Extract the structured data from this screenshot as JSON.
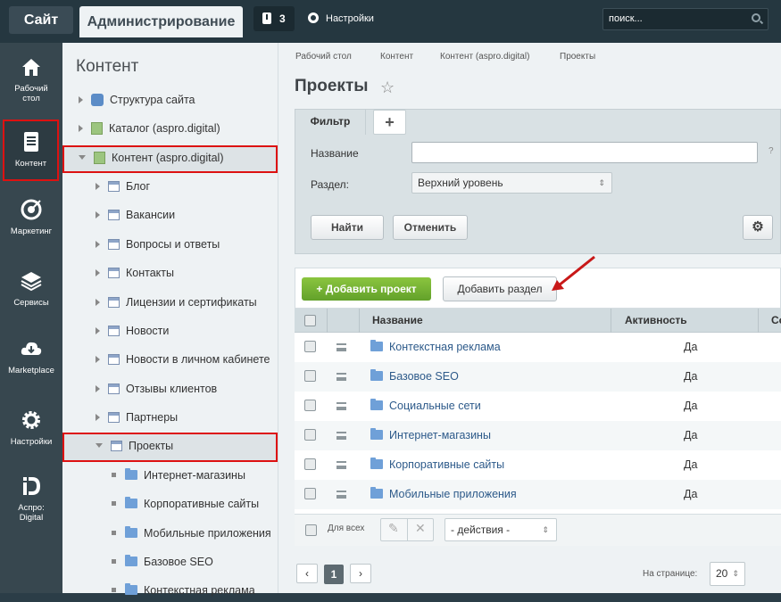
{
  "topbar": {
    "site_tab": "Сайт",
    "admin_tab": "Администрирование",
    "notifications_count": "3",
    "settings_label": "Настройки",
    "search_placeholder": "поиск..."
  },
  "leftnav": [
    {
      "label1": "Рабочий",
      "label2": "стол",
      "icon": "home-icon"
    },
    {
      "label1": "Контент",
      "label2": "",
      "icon": "document-icon"
    },
    {
      "label1": "Маркетинг",
      "label2": "",
      "icon": "target-icon"
    },
    {
      "label1": "Сервисы",
      "label2": "",
      "icon": "layers-icon"
    },
    {
      "label1": "Marketplace",
      "label2": "",
      "icon": "cloud-download-icon"
    },
    {
      "label1": "Настройки",
      "label2": "",
      "icon": "gear-icon"
    },
    {
      "label1": "Аспро:",
      "label2": "Digital",
      "icon": "aspro-logo-icon"
    }
  ],
  "tree": {
    "title": "Контент",
    "items": [
      "Структура сайта",
      "Каталог (aspro.digital)",
      "Контент (aspro.digital)",
      "Блог",
      "Вакансии",
      "Вопросы и ответы",
      "Контакты",
      "Лицензии и сертификаты",
      "Новости",
      "Новости в личном кабинете",
      "Отзывы клиентов",
      "Партнеры",
      "Проекты",
      "Интернет-магазины",
      "Корпоративные сайты",
      "Мобильные приложения",
      "Базовое SEO",
      "Контекстная реклама"
    ]
  },
  "breadcrumb": [
    "Рабочий стол",
    "Контент",
    "Контент (aspro.digital)",
    "Проекты"
  ],
  "page_title": "Проекты",
  "filter": {
    "tab": "Фильтр",
    "add_tab": "+",
    "name_label": "Название",
    "help": "?",
    "section_label": "Раздел:",
    "section_value": "Верхний уровень",
    "find": "Найти",
    "cancel": "Отменить"
  },
  "toolbar": {
    "add_project": "Добавить проект",
    "add_section": "Добавить раздел"
  },
  "grid": {
    "columns": [
      "Название",
      "Активность",
      "Со"
    ],
    "rows": [
      {
        "name": "Контекстная реклама",
        "active": "Да"
      },
      {
        "name": "Базовое SEO",
        "active": "Да"
      },
      {
        "name": "Социальные сети",
        "active": "Да"
      },
      {
        "name": "Интернет-магазины",
        "active": "Да"
      },
      {
        "name": "Корпоративные сайты",
        "active": "Да"
      },
      {
        "name": "Мобильные приложения",
        "active": "Да"
      }
    ],
    "for_all": "Для всех",
    "actions": "- действия -"
  },
  "pager": {
    "prev": "‹",
    "current": "1",
    "next": "›",
    "per_page_label": "На странице:",
    "per_page": "20"
  },
  "colors": {
    "highlight": "#dd1111",
    "green": "#6aa92f",
    "accent_link": "#2d5a8a"
  }
}
